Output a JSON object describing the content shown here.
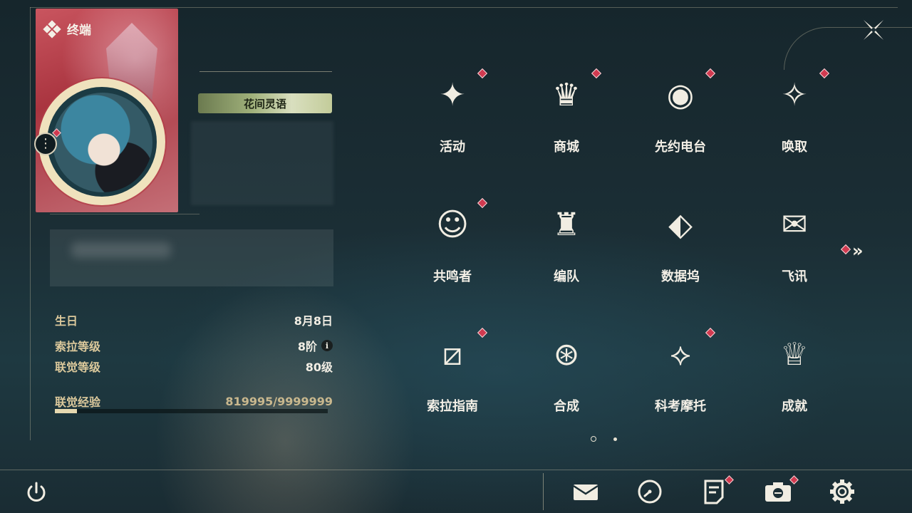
{
  "header": {
    "title": "终端",
    "title_icon": "diamond-cluster-icon",
    "close_icon": "close-x-icon"
  },
  "profile": {
    "badge_text": "花间灵语",
    "more_icon": "more-vertical-icon",
    "info": [
      {
        "label": "生日",
        "value": "8月8日"
      },
      {
        "label": "索拉等级",
        "value": "8阶",
        "icon": "info-icon",
        "icon_glyph": "i"
      },
      {
        "label": "联觉等级",
        "value": "80级"
      }
    ],
    "exp": {
      "label": "联觉经验",
      "value": "819995/9999999",
      "progress": 0.082
    }
  },
  "grid": [
    {
      "label": "活动",
      "icon": "sparkle-flag-icon",
      "glyph": "✦",
      "dot": true
    },
    {
      "label": "商城",
      "icon": "shopping-cart-icon",
      "glyph": "♛",
      "dot": true
    },
    {
      "label": "先约电台",
      "icon": "radio-disc-icon",
      "glyph": "◉",
      "dot": true
    },
    {
      "label": "唤取",
      "icon": "compass-star-icon",
      "glyph": "✧",
      "dot": true
    },
    {
      "label": "共鸣者",
      "icon": "character-head-icon",
      "glyph": "☺",
      "dot": true
    },
    {
      "label": "编队",
      "icon": "chess-pieces-icon",
      "glyph": "♜",
      "dot": false
    },
    {
      "label": "数据坞",
      "icon": "data-dock-icon",
      "glyph": "⬖",
      "dot": false
    },
    {
      "label": "飞讯",
      "icon": "message-bubble-icon",
      "glyph": "✉",
      "dot": false
    },
    {
      "label": "索拉指南",
      "icon": "guide-book-icon",
      "glyph": "⧄",
      "dot": true
    },
    {
      "label": "合成",
      "icon": "synthesis-icon",
      "glyph": "⊛",
      "dot": false
    },
    {
      "label": "科考摩托",
      "icon": "motorcycle-icon",
      "glyph": "⟡",
      "dot": true
    },
    {
      "label": "成就",
      "icon": "trophy-icon",
      "glyph": "♕",
      "dot": false
    }
  ],
  "pager": {
    "pages": 2,
    "current": 1,
    "next_icon": "double-chevron-right-icon",
    "next_glyph": "»"
  },
  "bottom_bar": {
    "power_icon": "power-icon",
    "items": [
      {
        "name": "mail-icon",
        "dot": false
      },
      {
        "name": "clock-icon",
        "dot": false
      },
      {
        "name": "notes-icon",
        "dot": true
      },
      {
        "name": "camera-icon",
        "dot": true
      },
      {
        "name": "settings-gear-icon",
        "dot": false
      }
    ]
  },
  "colors": {
    "accent_red": "#d13a50",
    "gold_label": "#dcc99c",
    "text": "#f3efe6"
  }
}
